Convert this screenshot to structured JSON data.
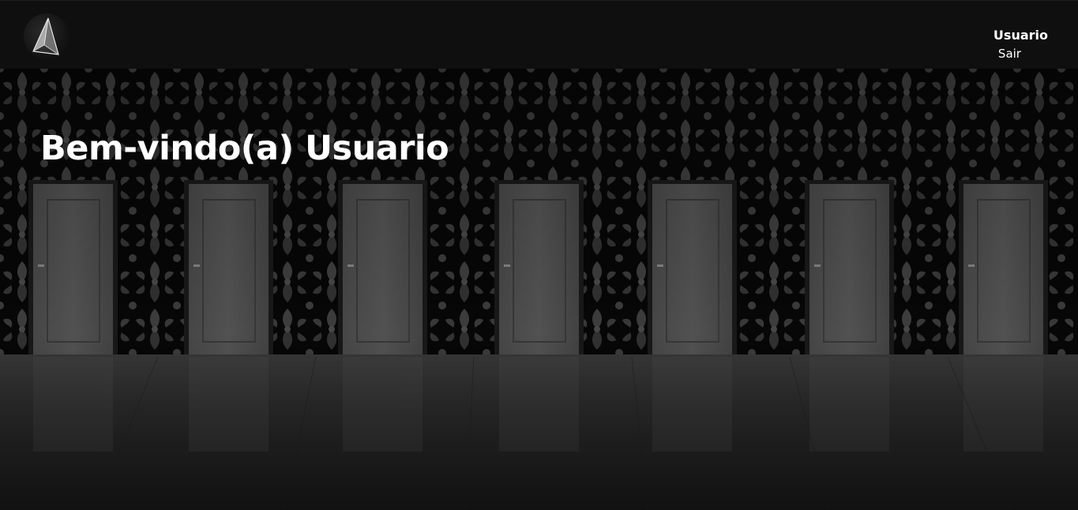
{
  "header": {
    "logo_icon": "triangle-logo-icon",
    "user_name": "Usuario",
    "logout_label": "Sair"
  },
  "hero": {
    "welcome_text": "Bem-vindo(a) Usuario",
    "background_image": "row-of-doors-damask-wallpaper"
  },
  "colors": {
    "header_bg": "#0f0f10",
    "text": "#ffffff"
  }
}
